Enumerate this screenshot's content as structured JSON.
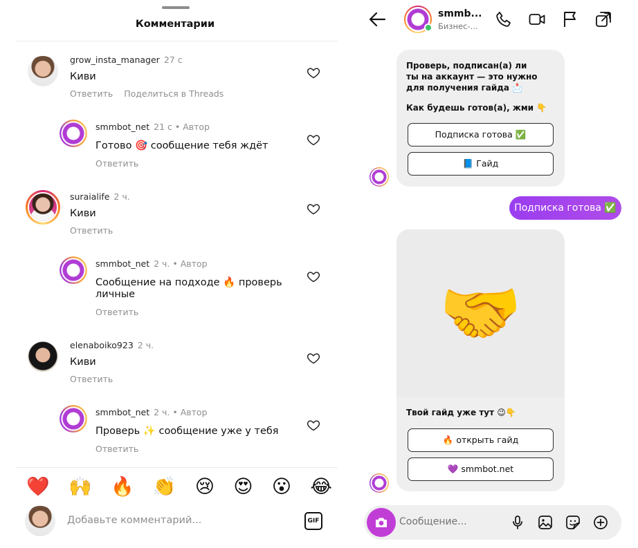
{
  "comments_sheet": {
    "title": "Комментарии",
    "comments": [
      {
        "username": "grow_insta_manager",
        "meta": "27 с",
        "text": "Киви",
        "actions": [
          "Ответить",
          "Поделиться в Threads"
        ]
      },
      {
        "username": "smmbot_net",
        "meta": "21 с • Автор",
        "text": "Готово 🎯 сообщение тебя ждёт",
        "actions": [
          "Ответить"
        ]
      },
      {
        "username": "suraialife",
        "meta": "2 ч.",
        "text": "Киви",
        "actions": [
          "Ответить"
        ]
      },
      {
        "username": "smmbot_net",
        "meta": "2 ч. • Автор",
        "text": "Сообщение на подходе 🔥 проверь личные",
        "actions": [
          "Ответить"
        ]
      },
      {
        "username": "elenaboiko923",
        "meta": "2 ч.",
        "text": "Киви",
        "actions": [
          "Ответить"
        ]
      },
      {
        "username": "smmbot_net",
        "meta": "2 ч. • Автор",
        "text": "Проверь ✨ сообщение уже у тебя",
        "actions": [
          "Ответить"
        ]
      }
    ],
    "emoji_reactions": [
      "❤️",
      "🙌",
      "🔥",
      "👏",
      "😢",
      "😍",
      "😮",
      "😂"
    ],
    "composer": {
      "placeholder": "Добавьте комментарий...",
      "gif_label": "GIF"
    }
  },
  "dm": {
    "header": {
      "name": "smmb...",
      "subtitle": "Бизнес-..."
    },
    "bot_message": {
      "text_line1": "Проверь, подписан(а) ли ты на аккаунт — это нужно для получения гайда 📩",
      "text_line2": "Как будешь готов(а), жми 👇",
      "buttons": [
        "Подписка готова ✅",
        "📘 Гайд"
      ]
    },
    "user_message": "Подписка готова ✅",
    "card": {
      "image_emoji": "🤝",
      "caption": "Твой гайд уже тут 😉👇",
      "buttons": [
        "🔥 открыть гайд",
        "💜 smmbot.net"
      ]
    },
    "input": {
      "placeholder": "Сообщение..."
    }
  },
  "colors": {
    "accent_purple": "#9a3df0",
    "online_green": "#3ac266",
    "muted_text": "#8e8e8e",
    "bubble_bg": "#efefef"
  },
  "icons": [
    "back-arrow-icon",
    "phone-icon",
    "video-icon",
    "flag-icon",
    "external-link-icon",
    "camera-icon",
    "microphone-icon",
    "image-icon",
    "sticker-icon",
    "plus-icon",
    "heart-icon"
  ]
}
